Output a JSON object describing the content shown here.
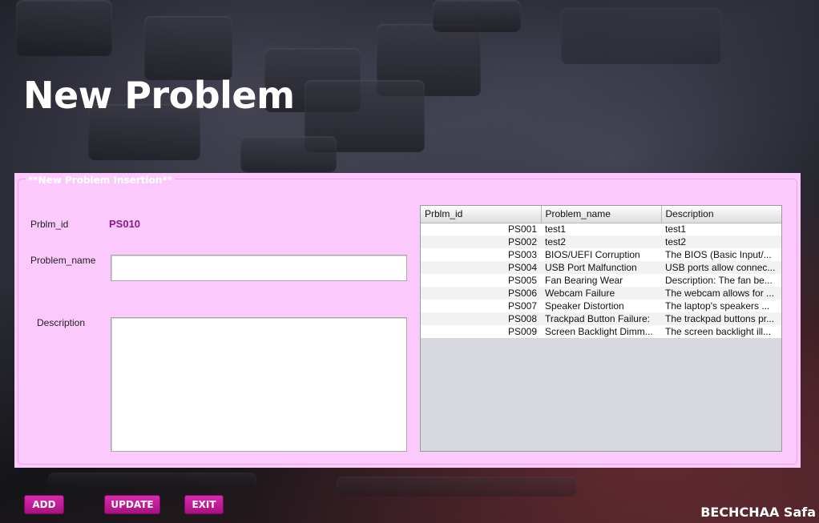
{
  "page": {
    "title": "New Problem",
    "author": "BECHCHAA Safa"
  },
  "form": {
    "legend": "**New Problem Insertion**",
    "id_label": "Prblm_id",
    "id_value": "PS010",
    "name_label": "Problem_name",
    "name_value": "",
    "description_label": "Description",
    "description_value": ""
  },
  "table": {
    "columns": [
      "Prblm_id",
      "Problem_name",
      "Description"
    ],
    "rows": [
      [
        "PS001",
        "test1",
        "test1"
      ],
      [
        "PS002",
        "test2",
        "test2"
      ],
      [
        "PS003",
        "BIOS/UEFI Corruption",
        "The BIOS (Basic Input/..."
      ],
      [
        "PS004",
        "USB Port Malfunction",
        "USB ports allow connec..."
      ],
      [
        "PS005",
        "Fan Bearing Wear",
        "Description: The fan be..."
      ],
      [
        "PS006",
        "Webcam Failure",
        "The webcam allows for ..."
      ],
      [
        "PS007",
        "Speaker Distortion",
        "The laptop's speakers ..."
      ],
      [
        "PS008",
        "Trackpad Button Failure:",
        "The trackpad buttons pr..."
      ],
      [
        "PS009",
        "Screen Backlight Dimm...",
        "The screen backlight ill..."
      ]
    ]
  },
  "buttons": {
    "add": "ADD",
    "update": "UPDATE",
    "exit": "EXIT"
  },
  "colors": {
    "panel": "#fcc9fc",
    "accent": "#b8168f",
    "id_text": "#8b1a8b"
  }
}
